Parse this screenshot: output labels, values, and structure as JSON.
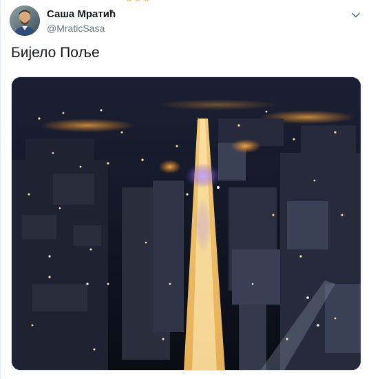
{
  "tweet": {
    "author": {
      "display_name": "Саша Мратић",
      "handle": "@MraticSasa",
      "avatar_icon": "person-avatar"
    },
    "menu_icon": "chevron-down-icon",
    "text": "Бијело Поље"
  },
  "top_strip": {
    "stars": "★★★"
  },
  "colors": {
    "name": "#14171a",
    "handle": "#657786",
    "border": "#e1e8ed",
    "star": "#f5a623"
  }
}
